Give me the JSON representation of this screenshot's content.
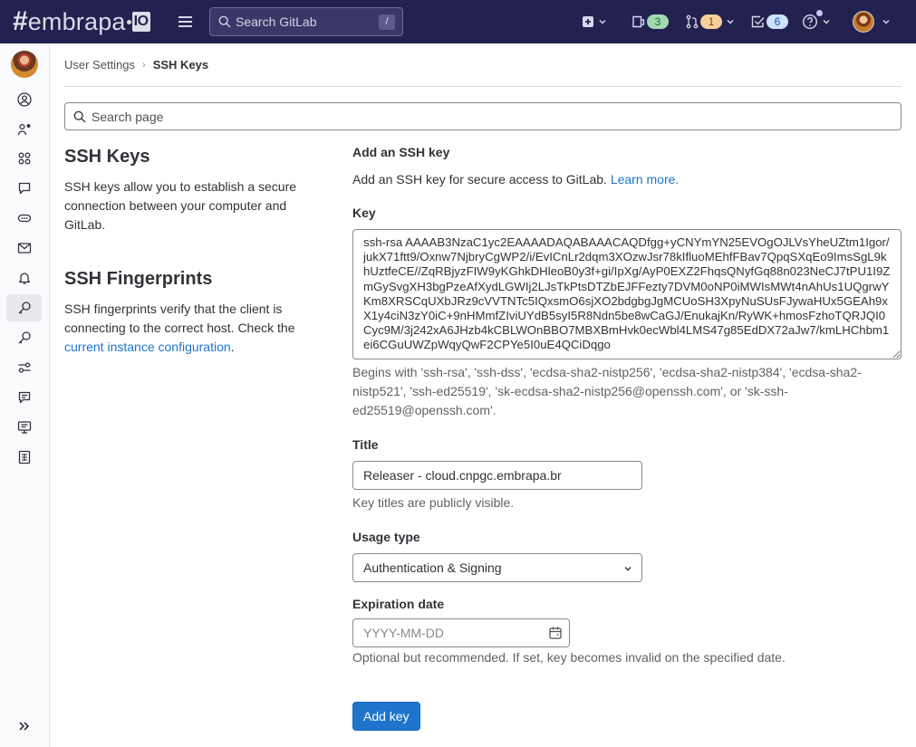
{
  "topbar": {
    "logo_hash": "#",
    "logo_word": "embrapa",
    "logo_badge": "IO",
    "search_placeholder": "Search GitLab",
    "search_shortcut": "/",
    "issues_count": "3",
    "merge_requests_count": "1",
    "todos_count": "6"
  },
  "sidebar": {
    "items": [
      {
        "name": "profile",
        "icon": "user-circle-icon"
      },
      {
        "name": "account",
        "icon": "user-settings-icon"
      },
      {
        "name": "applications",
        "icon": "applications-icon"
      },
      {
        "name": "chat",
        "icon": "comment-icon"
      },
      {
        "name": "access-tokens",
        "icon": "token-icon"
      },
      {
        "name": "emails",
        "icon": "mail-icon"
      },
      {
        "name": "notifications",
        "icon": "bell-icon"
      },
      {
        "name": "ssh-keys",
        "icon": "key-icon",
        "active": true
      },
      {
        "name": "gpg-keys",
        "icon": "key-icon"
      },
      {
        "name": "preferences",
        "icon": "preferences-icon"
      },
      {
        "name": "comment-templates",
        "icon": "comment-lines-icon"
      },
      {
        "name": "active-sessions",
        "icon": "monitor-icon"
      },
      {
        "name": "authentication-log",
        "icon": "log-icon"
      }
    ]
  },
  "breadcrumb": {
    "parent": "User Settings",
    "current": "SSH Keys"
  },
  "page_search": {
    "placeholder": "Search page"
  },
  "intro": {
    "ssh_keys_title": "SSH Keys",
    "ssh_keys_text": "SSH keys allow you to establish a secure connection between your computer and GitLab.",
    "fingerprints_title": "SSH Fingerprints",
    "fingerprints_text": "SSH fingerprints verify that the client is connecting to the correct host. Check the ",
    "fingerprints_link": "current instance configuration",
    "fingerprints_end": "."
  },
  "form": {
    "heading": "Add an SSH key",
    "description": "Add an SSH key for secure access to GitLab. ",
    "learn_more": "Learn more.",
    "key_label": "Key",
    "key_value": "ssh-rsa AAAAB3NzaC1yc2EAAAADAQABAAACAQDfgg+yCNYmYN25EVOgOJLVsYheUZtm1Igor/jukX71ftt9/Oxnw7NjbryCgWP2/i/EvICnLr2dqm3XOzwJsr78kIfluoMEhfFBav7QpqSXqEo9ImsSgL9khUztfeCE//ZqRBjyzFIW9yKGhkDHleoB0y3f+gi/IpXg/AyP0EXZ2FhqsQNyfGq88n023NeCJ7tPU1I9ZmGySvgXH3bgPzeAfXydLGWIj2LJsTkPtsDTZbEJFFezty7DVM0oNP0iMWIsMWt4nAhUs1UQgrwYKm8XRSCqUXbJRz9cVVTNTc5IQxsmO6sjXO2bdgbgJgMCUoSH3XpyNuSUsFJywaHUx5GEAh9xX1y4ciN3zY0iC+9nHMmfZIviUYdB5syI5R8Ndn5be8wCaGJ/EnukajKn/RyWK+hmosFzhoTQRJQI0Cyc9M/3j242xA6JHzb4kCBLWOnBBO7MBXBmHvk0ecWbl4LMS47g85EdDX72aJw7/kmLHChbm1ei6CGuUWZpWqyQwF2CPYe5I0uE4QCiDqgo",
    "key_help": "Begins with 'ssh-rsa', 'ssh-dss', 'ecdsa-sha2-nistp256', 'ecdsa-sha2-nistp384', 'ecdsa-sha2-nistp521', 'ssh-ed25519', 'sk-ecdsa-sha2-nistp256@openssh.com', or 'sk-ssh-ed25519@openssh.com'.",
    "title_label": "Title",
    "title_value": "Releaser - cloud.cnpgc.embrapa.br",
    "title_help": "Key titles are publicly visible.",
    "usage_label": "Usage type",
    "usage_value": "Authentication & Signing",
    "expiration_label": "Expiration date",
    "expiration_placeholder": "YYYY-MM-DD",
    "expiration_help": "Optional but recommended. If set, key becomes invalid on the specified date.",
    "submit_label": "Add key"
  },
  "colors": {
    "topbar": "#232150",
    "primary": "#1f75cb",
    "link": "#1f75cb"
  }
}
